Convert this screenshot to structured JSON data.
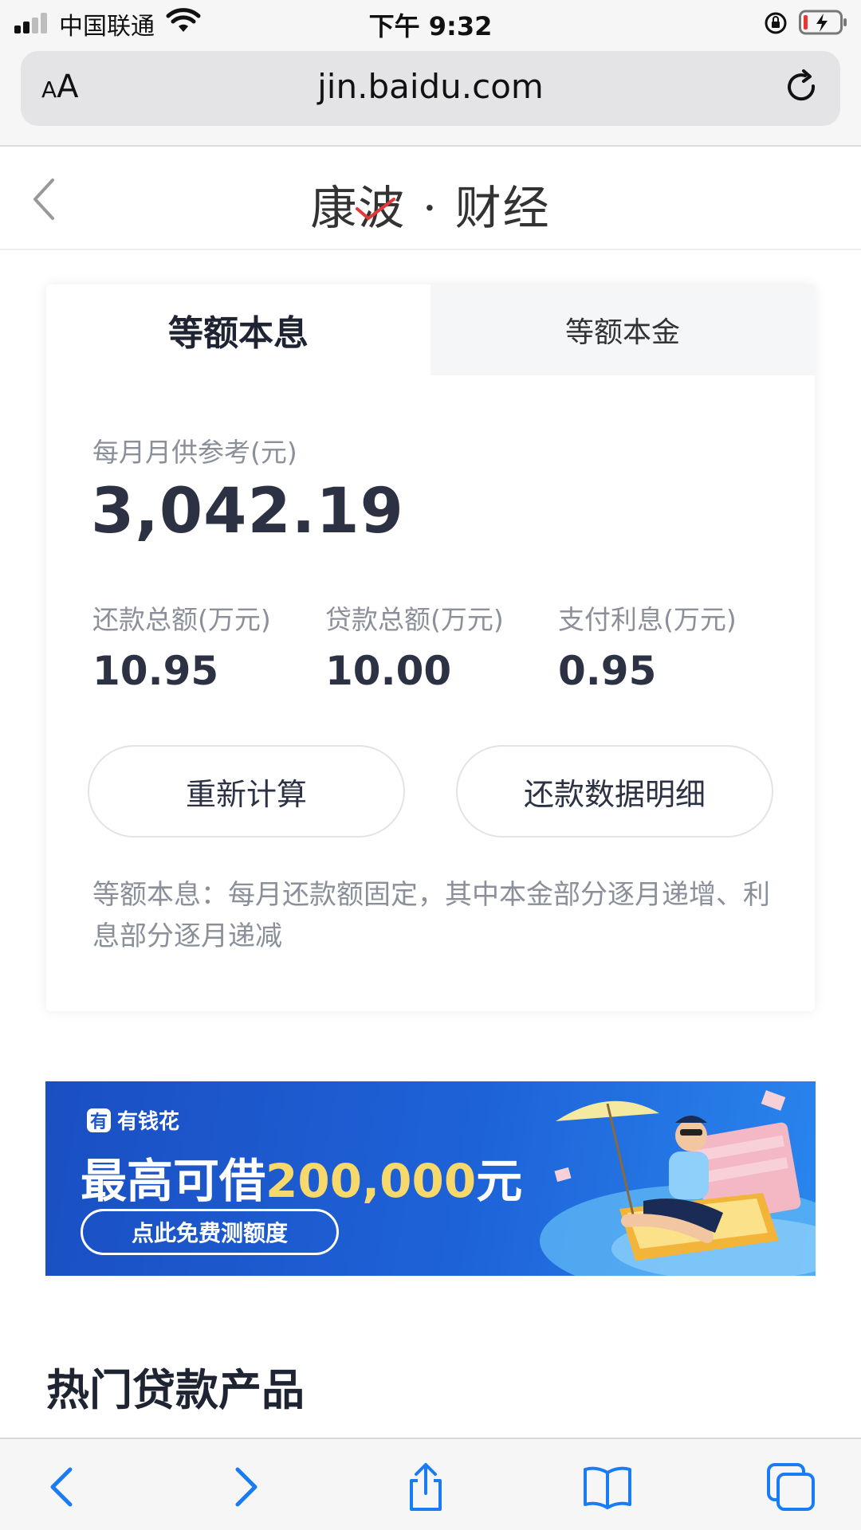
{
  "status_bar": {
    "carrier": "中国联通",
    "time": "下午 9:32"
  },
  "browser": {
    "aa_small": "A",
    "aa_large": "A",
    "url": "jin.baidu.com"
  },
  "header": {
    "logo_text": "康波 · 财经"
  },
  "calculator": {
    "tabs": [
      {
        "label": "等额本息",
        "active": true
      },
      {
        "label": "等额本金",
        "active": false
      }
    ],
    "monthly_label": "每月月供参考(元)",
    "monthly_value": "3,042.19",
    "stats": [
      {
        "label": "还款总额(万元)",
        "value": "10.95"
      },
      {
        "label": "贷款总额(万元)",
        "value": "10.00"
      },
      {
        "label": "支付利息(万元)",
        "value": "0.95"
      }
    ],
    "buttons": {
      "recalculate": "重新计算",
      "details": "还款数据明细"
    },
    "note": "等额本息：每月还款额固定，其中本金部分逐月递增、利息部分逐月递减"
  },
  "banner": {
    "brand_mark": "有",
    "brand_name": "有钱花",
    "headline_prefix": "最高可借",
    "headline_amount": "200,000",
    "headline_suffix": "元",
    "cta": "点此免费测额度",
    "colors": {
      "background": "#1e62d8",
      "amount": "#f6d96a"
    }
  },
  "section": {
    "title": "热门贷款产品"
  },
  "toolbar": {
    "icons": [
      "back-icon",
      "forward-icon",
      "share-icon",
      "bookmarks-icon",
      "tabs-icon"
    ],
    "accent_color": "#1a7cf5"
  }
}
